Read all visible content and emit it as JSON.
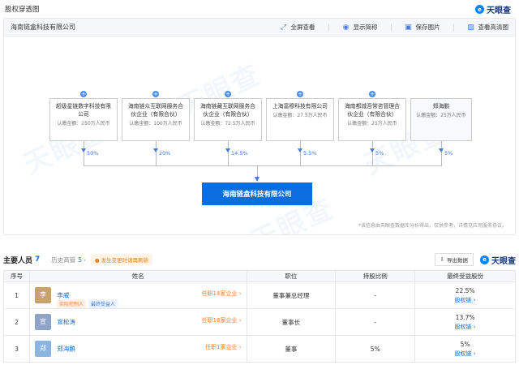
{
  "header": {
    "title": "股权穿透图",
    "brand": "天眼查"
  },
  "equity": {
    "company_name": "海南链盒科技有限公司",
    "tools": [
      {
        "icon": "expand-icon",
        "label": "全屏查看"
      },
      {
        "icon": "eye-icon",
        "label": "显示简称"
      },
      {
        "icon": "save-icon",
        "label": "保存图片"
      },
      {
        "icon": "image-icon",
        "label": "查看高清图"
      }
    ],
    "shareholders": [
      {
        "name": "超级星链数字科技有限公司",
        "capital": "认缴金额：250万人民币",
        "percent": "50%"
      },
      {
        "name": "海南链众互联网服务合伙企业（有限合伙）",
        "capital": "认缴金额：100万人民币",
        "percent": "20%"
      },
      {
        "name": "海南链藏互联网服务合伙企业（有限合伙）",
        "capital": "认缴金额：72.5万人民币",
        "percent": "14.5%"
      },
      {
        "name": "上海富穆科技有限公司",
        "capital": "认缴金额：27.5万人民币",
        "percent": "5.5%"
      },
      {
        "name": "海南都城吾常咨管理合伙企业（有限合伙）",
        "capital": "认缴金额：25万人民币",
        "percent": "5%"
      },
      {
        "name": "郑海鹏",
        "capital": "认缴金额：25万人民币",
        "percent": "5%"
      }
    ],
    "target": "海南链盒科技有限公司",
    "disclaimer": "*该信息由天眼查数据库分析得出，仅供参考，详情见应用服务协议。"
  },
  "personnel": {
    "title": "主要人员",
    "count": "7",
    "history_label": "历史高管",
    "history_count": "5",
    "change_tag": "发生变更时请再刷新",
    "export_label": "导出数据",
    "columns": [
      "序号",
      "姓名",
      "职位",
      "持股比例",
      "最终受益股份"
    ],
    "rows": [
      {
        "index": "1",
        "avatar": "李",
        "avatar_color": "#c9a26b",
        "name": "李威",
        "tags": [
          "实际控制人",
          "最终受益人"
        ],
        "roles": "任职14家企业",
        "position": "董事兼总经理",
        "share": "-",
        "final_share": "22.5%",
        "chain": "股权链"
      },
      {
        "index": "2",
        "avatar": "宣",
        "avatar_color": "#8fa3c7",
        "name": "宣松涛",
        "tags": [],
        "roles": "任职18家企业",
        "position": "董事长",
        "share": "-",
        "final_share": "13.7%",
        "chain": "股权链"
      },
      {
        "index": "3",
        "avatar": "郑",
        "avatar_color": "#8cb4e0",
        "name": "郑海鹏",
        "tags": [],
        "roles": "任职1家企业",
        "position": "董事",
        "share": "5%",
        "final_share": "5%",
        "chain": "股权链"
      }
    ]
  }
}
